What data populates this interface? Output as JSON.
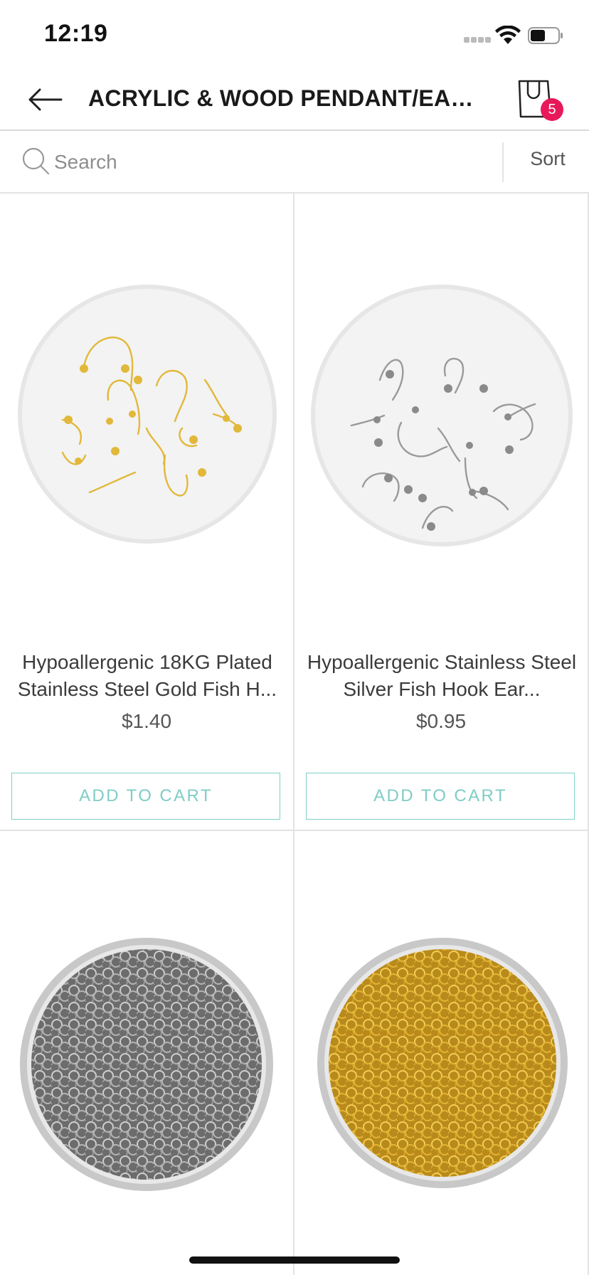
{
  "status_bar": {
    "time": "12:19",
    "signal_icon": "cellular-signal-icon",
    "wifi_icon": "wifi-icon",
    "battery_icon": "battery-icon"
  },
  "header": {
    "title": "ACRYLIC & WOOD PENDANT/EARRI...",
    "back_icon": "arrow-left-icon",
    "cart_icon": "shopping-bag-icon",
    "cart_count": "5"
  },
  "search": {
    "placeholder": "Search",
    "value": "",
    "sort_label": "Sort"
  },
  "colors": {
    "accent": "#7fcdc6",
    "badge": "#e8195a",
    "divider": "#e3e3e3"
  },
  "products": [
    {
      "name": "Hypoallergenic 18KG Plated Stainless Steel Gold Fish H...",
      "price": "$1.40",
      "button": "ADD TO CART",
      "image": "gold-fish-hook-earwires-image"
    },
    {
      "name": "Hypoallergenic Stainless Steel Silver Fish Hook Ear...",
      "price": "$0.95",
      "button": "ADD TO CART",
      "image": "silver-fish-hook-earwires-image"
    },
    {
      "name": "",
      "price": "",
      "button": "",
      "image": "silver-jump-rings-image"
    },
    {
      "name": "",
      "price": "",
      "button": "",
      "image": "gold-jump-rings-image"
    }
  ]
}
